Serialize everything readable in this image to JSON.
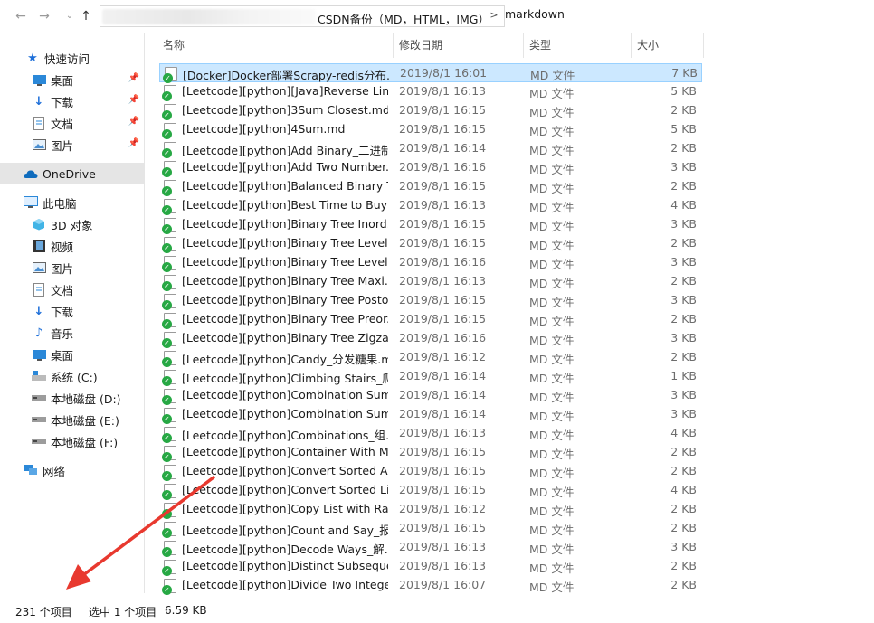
{
  "address": {
    "path_segment": "CSDN备份（MD，HTML，IMG）",
    "separator": ">",
    "current": "markdown"
  },
  "sidebar": {
    "items": [
      {
        "label": "快速访问",
        "icon": "star-icon"
      },
      {
        "label": "桌面",
        "icon": "desktop-icon"
      },
      {
        "label": "下载",
        "icon": "download-icon"
      },
      {
        "label": "文档",
        "icon": "document-icon"
      },
      {
        "label": "图片",
        "icon": "picture-icon"
      },
      {
        "label": "OneDrive",
        "icon": "cloud-icon"
      },
      {
        "label": "此电脑",
        "icon": "computer-icon"
      },
      {
        "label": "3D 对象",
        "icon": "cube-icon"
      },
      {
        "label": "视频",
        "icon": "video-icon"
      },
      {
        "label": "图片",
        "icon": "picture-icon"
      },
      {
        "label": "文档",
        "icon": "document-icon"
      },
      {
        "label": "下载",
        "icon": "download-icon"
      },
      {
        "label": "音乐",
        "icon": "music-icon"
      },
      {
        "label": "桌面",
        "icon": "desktop-icon"
      },
      {
        "label": "系统 (C:)",
        "icon": "system-drive-icon"
      },
      {
        "label": "本地磁盘 (D:)",
        "icon": "drive-icon"
      },
      {
        "label": "本地磁盘 (E:)",
        "icon": "drive-icon"
      },
      {
        "label": "本地磁盘 (F:)",
        "icon": "drive-icon"
      },
      {
        "label": "网络",
        "icon": "network-icon"
      }
    ]
  },
  "columns": {
    "name": "名称",
    "date": "修改日期",
    "type": "类型",
    "size": "大小"
  },
  "files": [
    {
      "name": "[Docker]Docker部署Scrapy-redis分布...",
      "date": "2019/8/1 16:01",
      "type": "MD 文件",
      "size": "7 KB"
    },
    {
      "name": "[Leetcode][python][Java]Reverse Link...",
      "date": "2019/8/1 16:13",
      "type": "MD 文件",
      "size": "5 KB"
    },
    {
      "name": "[Leetcode][python]3Sum Closest.md",
      "date": "2019/8/1 16:15",
      "type": "MD 文件",
      "size": "2 KB"
    },
    {
      "name": "[Leetcode][python]4Sum.md",
      "date": "2019/8/1 16:15",
      "type": "MD 文件",
      "size": "5 KB"
    },
    {
      "name": "[Leetcode][python]Add Binary_二进制...",
      "date": "2019/8/1 16:14",
      "type": "MD 文件",
      "size": "2 KB"
    },
    {
      "name": "[Leetcode][python]Add Two Number...",
      "date": "2019/8/1 16:16",
      "type": "MD 文件",
      "size": "3 KB"
    },
    {
      "name": "[Leetcode][python]Balanced Binary T...",
      "date": "2019/8/1 16:15",
      "type": "MD 文件",
      "size": "2 KB"
    },
    {
      "name": "[Leetcode][python]Best Time to Buy ...",
      "date": "2019/8/1 16:13",
      "type": "MD 文件",
      "size": "4 KB"
    },
    {
      "name": "[Leetcode][python]Binary Tree Inord...",
      "date": "2019/8/1 16:15",
      "type": "MD 文件",
      "size": "3 KB"
    },
    {
      "name": "[Leetcode][python]Binary Tree Level ...",
      "date": "2019/8/1 16:15",
      "type": "MD 文件",
      "size": "2 KB"
    },
    {
      "name": "[Leetcode][python]Binary Tree Level ...",
      "date": "2019/8/1 16:16",
      "type": "MD 文件",
      "size": "3 KB"
    },
    {
      "name": "[Leetcode][python]Binary Tree Maxi...",
      "date": "2019/8/1 16:13",
      "type": "MD 文件",
      "size": "2 KB"
    },
    {
      "name": "[Leetcode][python]Binary Tree Postor...",
      "date": "2019/8/1 16:15",
      "type": "MD 文件",
      "size": "3 KB"
    },
    {
      "name": "[Leetcode][python]Binary Tree Preor...",
      "date": "2019/8/1 16:15",
      "type": "MD 文件",
      "size": "2 KB"
    },
    {
      "name": "[Leetcode][python]Binary Tree Zigza...",
      "date": "2019/8/1 16:16",
      "type": "MD 文件",
      "size": "3 KB"
    },
    {
      "name": "[Leetcode][python]Candy_分发糖果.md",
      "date": "2019/8/1 16:12",
      "type": "MD 文件",
      "size": "2 KB"
    },
    {
      "name": "[Leetcode][python]Climbing Stairs_爬...",
      "date": "2019/8/1 16:14",
      "type": "MD 文件",
      "size": "1 KB"
    },
    {
      "name": "[Leetcode][python]Combination Sum ...",
      "date": "2019/8/1 16:14",
      "type": "MD 文件",
      "size": "3 KB"
    },
    {
      "name": "[Leetcode][python]Combination Sum_...",
      "date": "2019/8/1 16:14",
      "type": "MD 文件",
      "size": "3 KB"
    },
    {
      "name": "[Leetcode][python]Combinations_组...",
      "date": "2019/8/1 16:13",
      "type": "MD 文件",
      "size": "4 KB"
    },
    {
      "name": "[Leetcode][python]Container With M...",
      "date": "2019/8/1 16:15",
      "type": "MD 文件",
      "size": "2 KB"
    },
    {
      "name": "[Leetcode][python]Convert Sorted Ar...",
      "date": "2019/8/1 16:15",
      "type": "MD 文件",
      "size": "2 KB"
    },
    {
      "name": "[Leetcode][python]Convert Sorted Lis...",
      "date": "2019/8/1 16:15",
      "type": "MD 文件",
      "size": "4 KB"
    },
    {
      "name": "[Leetcode][python]Copy List with Ran...",
      "date": "2019/8/1 16:12",
      "type": "MD 文件",
      "size": "2 KB"
    },
    {
      "name": "[Leetcode][python]Count and Say_报...",
      "date": "2019/8/1 16:15",
      "type": "MD 文件",
      "size": "2 KB"
    },
    {
      "name": "[Leetcode][python]Decode Ways_解...",
      "date": "2019/8/1 16:13",
      "type": "MD 文件",
      "size": "3 KB"
    },
    {
      "name": "[Leetcode][python]Distinct Subseque...",
      "date": "2019/8/1 16:13",
      "type": "MD 文件",
      "size": "2 KB"
    },
    {
      "name": "[Leetcode][python]Divide Two Intege...",
      "date": "2019/8/1 16:07",
      "type": "MD 文件",
      "size": "2 KB"
    }
  ],
  "status": {
    "item_count": "231 个项目",
    "selected": "选中 1 个项目",
    "selected_size": "6.59 KB"
  },
  "colors": {
    "selection": "#cce8ff",
    "arrow": "#e8392f"
  }
}
